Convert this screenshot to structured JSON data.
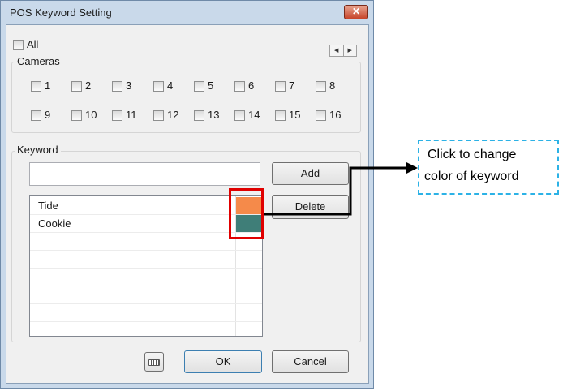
{
  "dialog": {
    "title": "POS Keyword Setting",
    "close_icon": "close-icon"
  },
  "all_checkbox": {
    "label": "All",
    "checked": false
  },
  "cameras": {
    "legend": "Cameras",
    "items": [
      "1",
      "2",
      "3",
      "4",
      "5",
      "6",
      "7",
      "8",
      "9",
      "10",
      "11",
      "12",
      "13",
      "14",
      "15",
      "16"
    ]
  },
  "keyword": {
    "legend": "Keyword",
    "input_value": "",
    "add_label": "Add",
    "delete_label": "Delete",
    "list": [
      {
        "text": "Tide",
        "color": "#f58a4a"
      },
      {
        "text": "Cookie",
        "color": "#3f7e78"
      }
    ]
  },
  "footer": {
    "keyboard_icon": "keyboard-icon",
    "ok_label": "OK",
    "cancel_label": "Cancel"
  },
  "annotation": {
    "line1": "Click to change",
    "line2": "color of keyword",
    "highlight_color": "#e00000",
    "callout_color": "#2cb2e6"
  }
}
